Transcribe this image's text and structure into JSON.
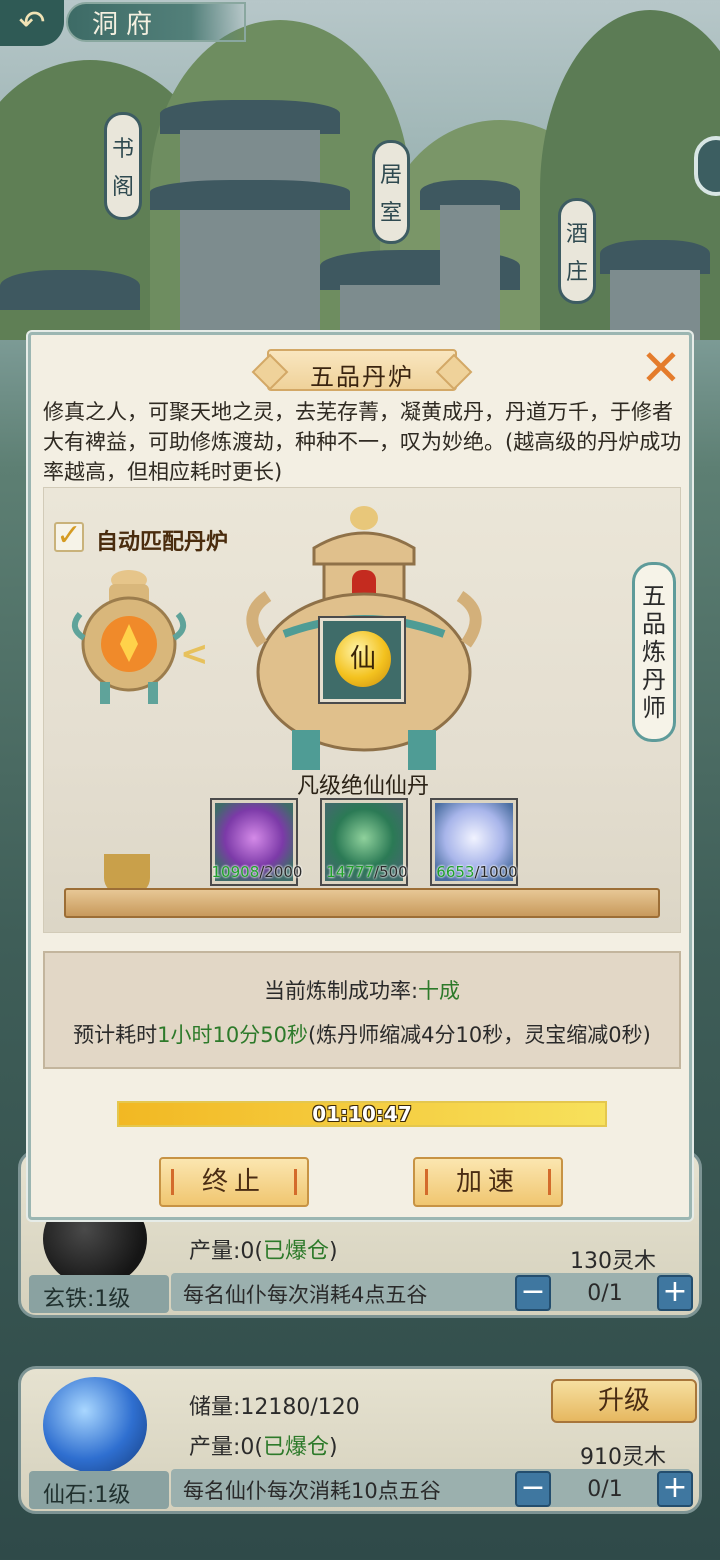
{
  "header": {
    "back_icon": "back-arrow-icon",
    "title": "洞府"
  },
  "buildings": [
    {
      "name": "书阁",
      "chars": [
        "书",
        "阁"
      ]
    },
    {
      "name": "居室",
      "chars": [
        "居",
        "室"
      ]
    },
    {
      "name": "酒庄",
      "chars": [
        "酒",
        "庄"
      ]
    }
  ],
  "dialog": {
    "title": "五品丹炉",
    "close_icon": "close-x-icon",
    "description": "修真之人，可聚天地之灵，去芜存菁，凝黄成丹，丹道万千，于修者大有裨益，可助修炼渡劫，种种不一，叹为妙绝。(越高级的丹炉成功率越高，但相应耗时更长)",
    "auto_match_label": "自动匹配丹炉",
    "auto_match_checked": true,
    "master_sign": [
      "五",
      "品",
      "炼",
      "丹",
      "师"
    ],
    "pill_glyph": "仙",
    "pill_name": "凡级绝仙仙丹",
    "materials": [
      {
        "name": "purple-orchid",
        "have": "10908",
        "need": "/2000"
      },
      {
        "name": "green-herb",
        "have": "14777",
        "need": "/500"
      },
      {
        "name": "crystal-lotus",
        "have": "6653",
        "need": "/1000"
      }
    ],
    "rate_prefix": "当前炼制成功率:",
    "rate_value": "十成",
    "time_prefix": "预计耗时",
    "time_value": "1小时10分50秒",
    "time_suffix": "(炼丹师缩减4分10秒，灵宝缩减0秒)",
    "progress_text": "01:10:47",
    "progress_fraction": 1.0,
    "stop_label": "终止",
    "speed_label": "加速"
  },
  "resources": [
    {
      "name": "玄铁:1级",
      "capacity": "",
      "output_prefix": "产量:0(",
      "output_status": "已爆仓",
      "output_suffix": ")",
      "cost": "130灵木",
      "desc": "每名仙仆每次消耗4点五谷",
      "minus": "−",
      "count": "0/1",
      "plus": "+",
      "color": "#2b2b2b"
    },
    {
      "name": "仙石:1级",
      "capacity": "储量:12180/120",
      "output_prefix": "产量:0(",
      "output_status": "已爆仓",
      "output_suffix": ")",
      "cost": "910灵木",
      "upgrade": "升级",
      "desc": "每名仙仆每次消耗10点五谷",
      "minus": "−",
      "count": "0/1",
      "plus": "+",
      "color": "#3a7fd0"
    }
  ]
}
